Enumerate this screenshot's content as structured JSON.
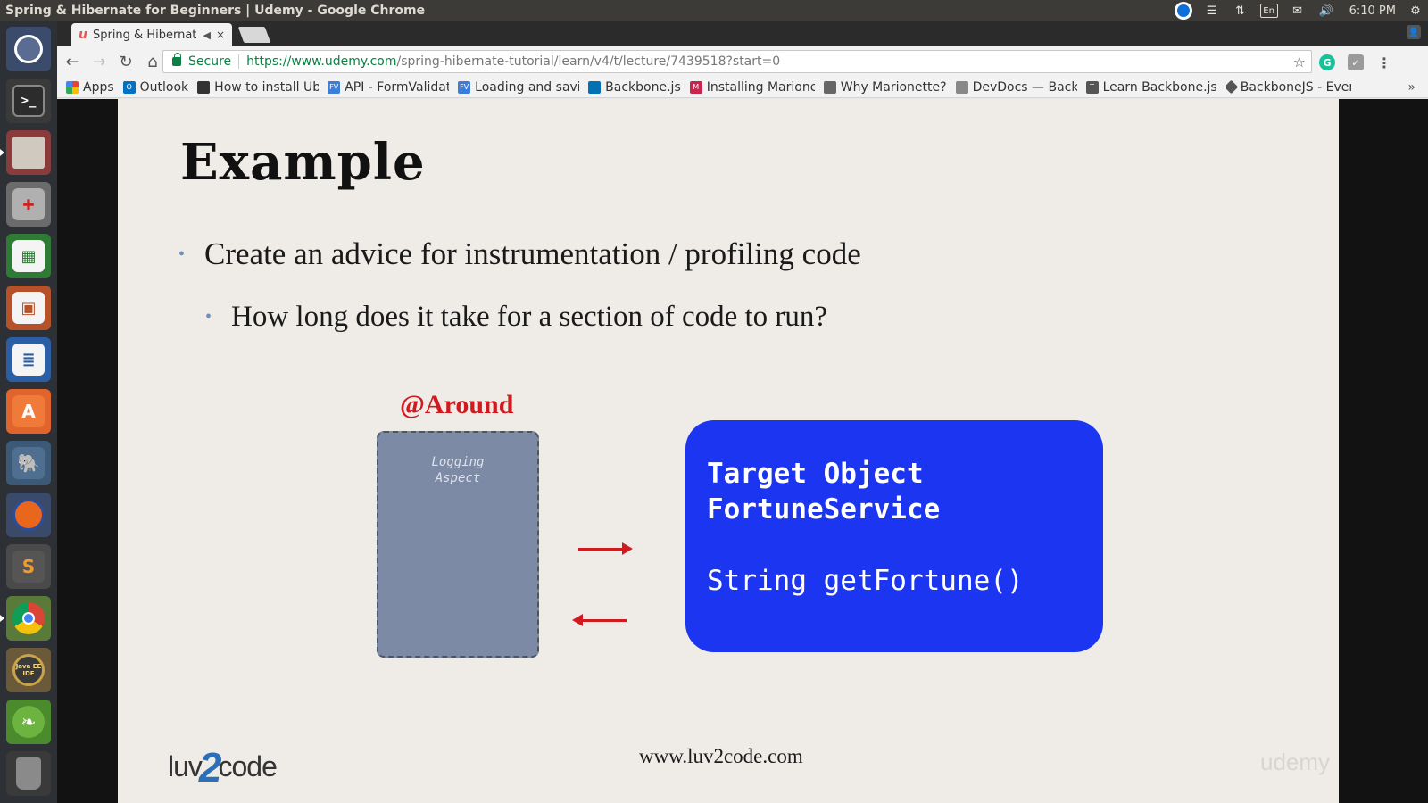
{
  "top_panel": {
    "window_title": "Spring & Hibernate for Beginners | Udemy - Google Chrome",
    "keyboard_layout": "En",
    "clock": "6:10 PM"
  },
  "launcher": {
    "items": [
      {
        "name": "ubuntu-dash",
        "icon": "ubuntu-logo-icon"
      },
      {
        "name": "terminal",
        "icon": "terminal-icon"
      },
      {
        "name": "files",
        "icon": "file-cabinet-icon"
      },
      {
        "name": "system-settings",
        "icon": "settings-tools-icon"
      },
      {
        "name": "libreoffice-calc",
        "icon": "spreadsheet-icon"
      },
      {
        "name": "libreoffice-impress",
        "icon": "presentation-icon"
      },
      {
        "name": "libreoffice-writer",
        "icon": "document-icon"
      },
      {
        "name": "software-center",
        "icon": "shopping-bag-icon"
      },
      {
        "name": "pgadmin",
        "icon": "elephant-icon"
      },
      {
        "name": "firefox",
        "icon": "firefox-icon"
      },
      {
        "name": "sublime-text",
        "icon": "sublime-icon"
      },
      {
        "name": "chrome",
        "icon": "chrome-icon"
      },
      {
        "name": "eclipse-java-ee",
        "icon": "java-ee-ide-icon"
      },
      {
        "name": "spring-tool-suite",
        "icon": "spring-leaf-icon"
      },
      {
        "name": "trash",
        "icon": "trash-icon"
      }
    ],
    "java_ee_label": "Java EE IDE"
  },
  "browser": {
    "tab": {
      "title": "Spring & Hibernate",
      "close": "×",
      "audio": "◀"
    },
    "secure_label": "Secure",
    "url_host": "https://www.udemy.com",
    "url_path": "/spring-hibernate-tutorial/learn/v4/t/lecture/7439518?start=0",
    "bookmarks": [
      {
        "label": "Apps",
        "fav": "",
        "color": "#4285f4"
      },
      {
        "label": "Outlook",
        "fav": "O",
        "color": "#0072c6"
      },
      {
        "label": "How to install Ubu",
        "fav": "",
        "color": "#333333"
      },
      {
        "label": "API - FormValidati",
        "fav": "FV",
        "color": "#3b7dd8"
      },
      {
        "label": "Loading and savinc",
        "fav": "FV",
        "color": "#3b7dd8"
      },
      {
        "label": "Backbone.js",
        "fav": "",
        "color": "#0071b5"
      },
      {
        "label": "Installing Marione",
        "fav": "M",
        "color": "#c7254e"
      },
      {
        "label": "Why Marionette?",
        "fav": "",
        "color": "#666666"
      },
      {
        "label": "DevDocs — Backb",
        "fav": "",
        "color": "#888888"
      },
      {
        "label": "Learn Backbone.js",
        "fav": "T",
        "color": "#555555"
      },
      {
        "label": "BackboneJS - Ever",
        "fav": "",
        "color": "#555555"
      }
    ],
    "bookmarks_overflow": "»"
  },
  "slide": {
    "title": "Example",
    "bullets": [
      "Create an advice for instrumentation / profiling code",
      "How long does it take for a section of code to run?"
    ],
    "around_label": "@Around",
    "aspect_line1": "Logging",
    "aspect_line2": "Aspect",
    "target_line1": "Target Object",
    "target_line2": "FortuneService",
    "target_method": "String getFortune()",
    "logo_part1": "luv",
    "logo_part2": "2",
    "logo_part3": "code",
    "footer_url": "www.luv2code.com",
    "watermark": "udemy"
  },
  "colors": {
    "accent_red": "#d11a20",
    "target_blue": "#1b35f0",
    "aspect_gray": "#7d8aa5"
  }
}
